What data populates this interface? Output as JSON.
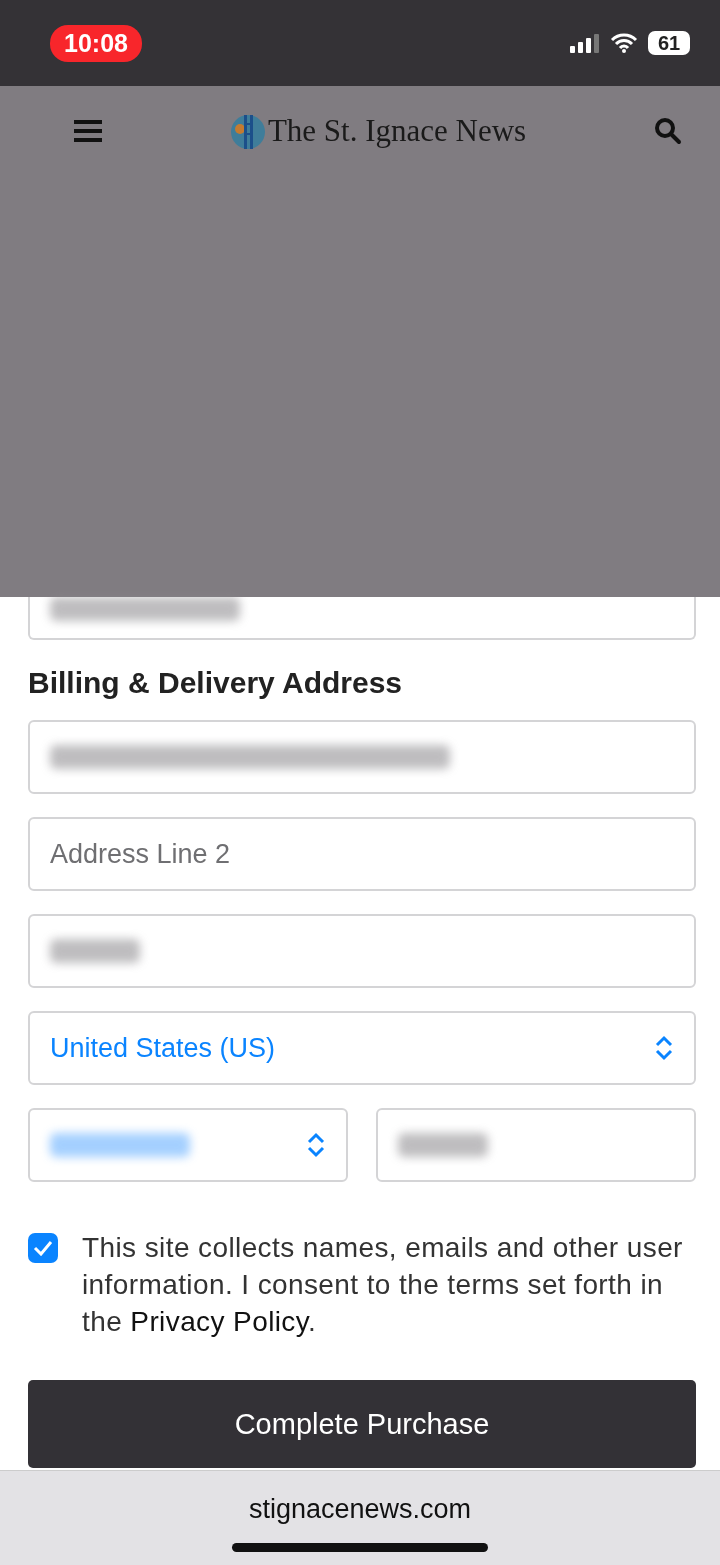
{
  "status_bar": {
    "time": "10:08",
    "battery": "61"
  },
  "header": {
    "logo_text": "The St. Ignace News"
  },
  "form": {
    "cut_field": {
      "kind": "blurred"
    },
    "heading": "Billing & Delivery Address",
    "fields": [
      {
        "kind": "blurred"
      },
      {
        "kind": "text",
        "placeholder": "Address Line 2"
      },
      {
        "kind": "blurred"
      },
      {
        "kind": "select",
        "value": "United States (US)"
      }
    ],
    "row": [
      {
        "kind": "select_blurred"
      },
      {
        "kind": "blurred"
      }
    ],
    "consent": {
      "checked": true,
      "text": "This site collects names, emails and other user information. I consent to the terms set forth in the ",
      "link": "Privacy Policy",
      "after": "."
    },
    "submit": "Complete Purchase"
  },
  "address_bar": {
    "url": "stignacenews.com"
  }
}
